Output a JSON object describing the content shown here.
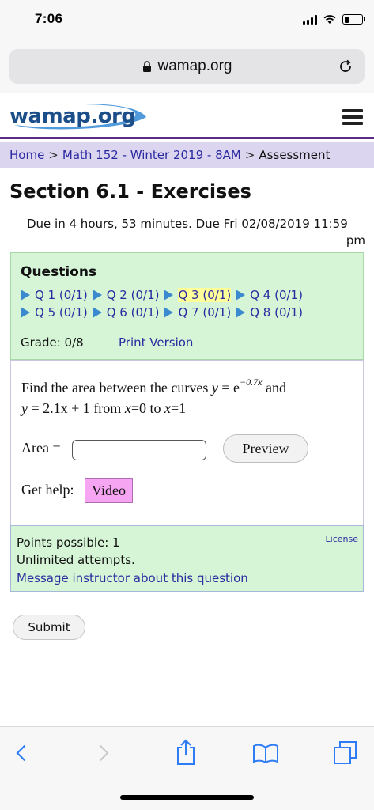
{
  "status": {
    "time": "7:06"
  },
  "browser": {
    "url": "wamap.org"
  },
  "site": {
    "logo_text": "wamap.org"
  },
  "breadcrumb": {
    "home": "Home",
    "course": "Math 152 - Winter 2019 - 8AM",
    "current": "Assessment",
    "separator": ">"
  },
  "page": {
    "title": "Section 6.1 - Exercises",
    "due_line1": "Due in 4 hours, 53 minutes. Due Fri 02/08/2019 11:59",
    "due_line2": "pm"
  },
  "questions": {
    "heading": "Questions",
    "items": [
      {
        "label": "Q 1 (0/1)"
      },
      {
        "label": "Q 2 (0/1)"
      },
      {
        "label": "Q 3 (0/1)",
        "current": true
      },
      {
        "label": "Q 4 (0/1)"
      },
      {
        "label": "Q 5 (0/1)"
      },
      {
        "label": "Q 6 (0/1)"
      },
      {
        "label": "Q 7 (0/1)"
      },
      {
        "label": "Q 8 (0/1)"
      }
    ],
    "grade": "Grade: 0/8",
    "print_version": "Print Version"
  },
  "question": {
    "text_prefix": "Find the area between the curves ",
    "y1": "y",
    "eq1": " = e",
    "exponent": "−0.7x",
    "and": " and",
    "y2": "y",
    "eq2": " = 2.1x + 1",
    "range_prefix": " from ",
    "x0": "x",
    "range_mid": "=0 to ",
    "x1": "x",
    "range_end": "=1",
    "area_label": "Area =",
    "area_value": "",
    "preview_label": "Preview",
    "help_label": "Get help:",
    "video_label": "Video"
  },
  "points": {
    "license": "License",
    "possible": "Points possible: 1",
    "attempts": "Unlimited attempts.",
    "message_link": "Message instructor about this question"
  },
  "submit_label": "Submit",
  "colors": {
    "accent_purple": "#5b2b86",
    "breadcrumb_bg": "#dcd5f0",
    "link": "#2a2aa0",
    "green_box": "#d6f5d6",
    "video_pink": "#f5a5f2",
    "current_highlight": "#ffff9a",
    "ios_blue": "#2f7df6"
  }
}
